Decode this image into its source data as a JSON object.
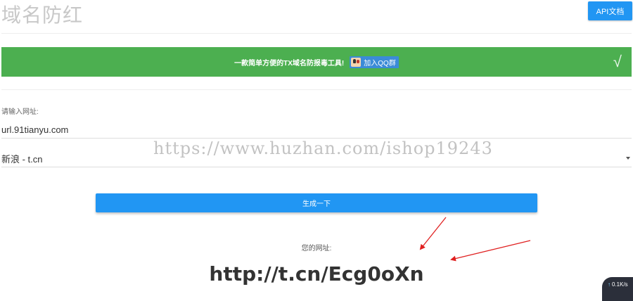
{
  "header": {
    "title": "域名防红",
    "api_button": "API文档"
  },
  "banner": {
    "text": "一款简单方便的TX域名防报毒工具!",
    "qq_button": "加入QQ群",
    "check": "√",
    "color": "#4caf50"
  },
  "form": {
    "label": "请输入网址:",
    "url_value": "url.91tianyu.com",
    "select_value": "新浪 - t.cn",
    "generate_button": "生成一下"
  },
  "watermark": "https://www.huzhan.com/ishop19243",
  "result": {
    "label": "您的网址:",
    "url": "http://t.cn/Ecg0oXn"
  },
  "speed_widget": {
    "arrow": "↑",
    "value": "0.1",
    "unit": "K/s"
  },
  "colors": {
    "accent": "#2196f3",
    "arrow": "#e02020"
  }
}
